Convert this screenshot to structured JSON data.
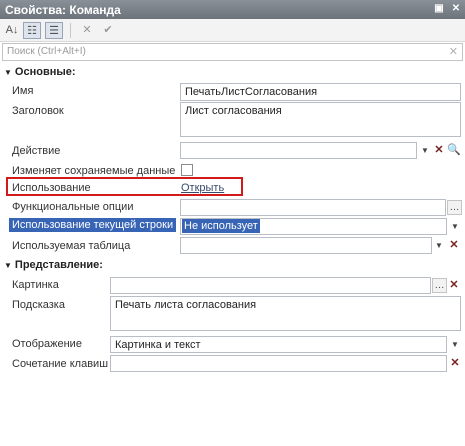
{
  "window": {
    "title": "Свойства: Команда"
  },
  "toolbar": {
    "sort_alpha_icon": "sort-az-icon",
    "categories_icon": "categories-icon",
    "props_icon": "properties-icon",
    "clear_icon": "cross-icon",
    "apply_icon": "check-icon"
  },
  "search": {
    "placeholder": "Поиск (Ctrl+Alt+I)"
  },
  "groups": {
    "basic": "Основные:",
    "presentation": "Представление:"
  },
  "props": {
    "name_label": "Имя",
    "name_value": "ПечатьЛистСогласования",
    "title_label": "Заголовок",
    "title_value": "Лист согласования",
    "action_label": "Действие",
    "action_value": "",
    "modifies_label": "Изменяет сохраняемые данные",
    "usage_label": "Использование",
    "usage_link": "Открыть",
    "func_options_label": "Функциональные опции",
    "func_options_value": "",
    "current_row_label": "Использование текущей строки",
    "current_row_value": "Не использует",
    "table_label": "Используемая таблица",
    "table_value": "",
    "picture_label": "Картинка",
    "picture_value": "",
    "tooltip_label": "Подсказка",
    "tooltip_value": "Печать листа согласования",
    "display_label": "Отображение",
    "display_value": "Картинка и текст",
    "shortcut_label": "Сочетание клавиш",
    "shortcut_value": ""
  },
  "colors": {
    "selection": "#3864b5",
    "highlight_box": "#d31a1a"
  }
}
